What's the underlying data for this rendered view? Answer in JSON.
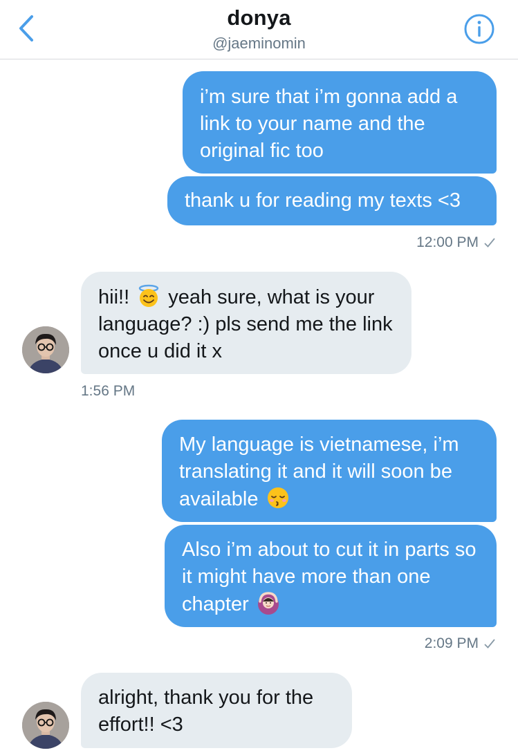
{
  "header": {
    "title": "donya",
    "handle": "@jaeminomin",
    "back_icon": "chevron-left-icon",
    "info_icon": "info-icon",
    "accent_color": "#4a9ee9"
  },
  "messages": {
    "m1": "i’m sure that i’m gonna add a link to your name and the original fic too",
    "m2": "thank u for reading my texts <3",
    "t1": "12:00 PM",
    "m3_before": "hii!! ",
    "m3_emoji": "smiling-face-with-halo",
    "m3_after": " yeah sure, what is your language? :) pls send me the link once u did it x",
    "t2": "1:56 PM",
    "m4_text": "My language is vietnamese, i’m translating it and it will soon be available ",
    "m4_emoji": "kissing-face-with-closed-eyes",
    "m5_text": "Also i’m about to cut it in parts so it might have more than one chapter ",
    "m5_emoji": "person-gesturing-ok",
    "t3": "2:09 PM",
    "m6": "alright, thank you for the effort!! <3"
  },
  "colors": {
    "sent_bubble": "#4a9ee9",
    "received_bubble": "#e6ecf0",
    "timestamp": "#657786"
  }
}
